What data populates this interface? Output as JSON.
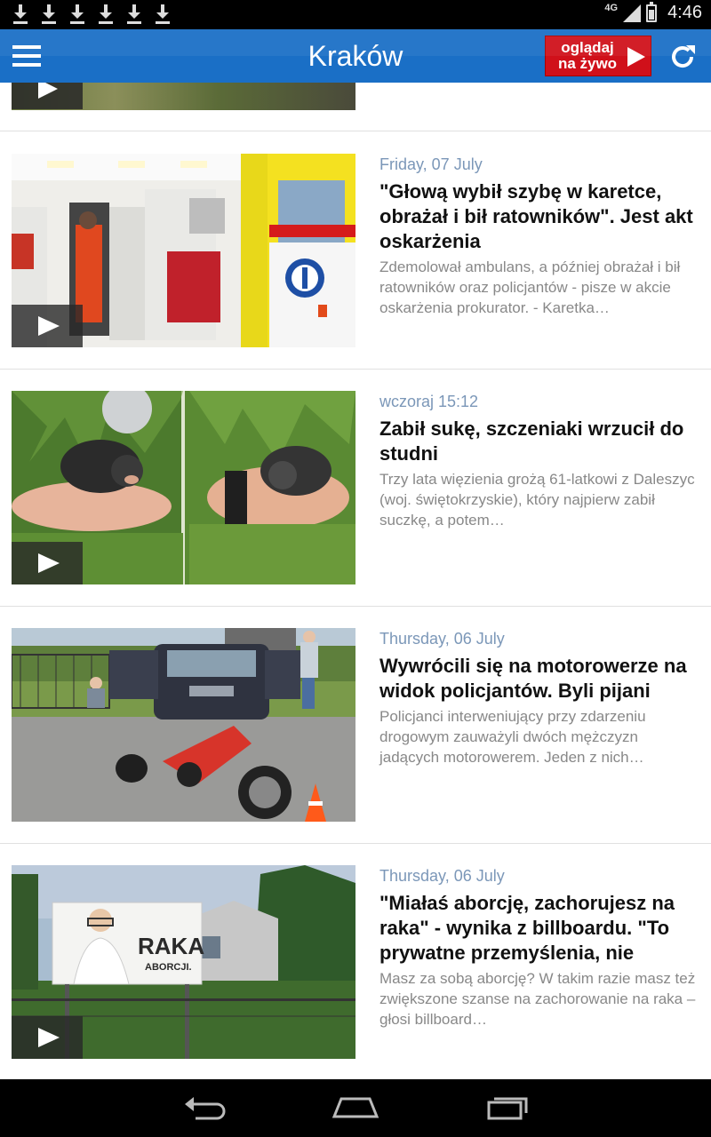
{
  "status_bar": {
    "network": "4G",
    "time": "4:46",
    "download_icons": [
      "download-icon",
      "download-icon",
      "download-icon",
      "download-icon",
      "download-icon",
      "download-icon"
    ]
  },
  "app_bar": {
    "title": "Kraków",
    "live_button_label": "oglądaj na żywo",
    "accent_color": "#1a6fc6",
    "live_color": "#d0101a"
  },
  "articles": [
    {
      "date": "Friday, 07 July",
      "title": "\"Głową wybił szybę w karetce, obrażał i bił ratowników\". Jest akt oskarżenia",
      "description": "Zdemolował ambulans, a później obrażał i bił ratowników oraz policjantów - pisze w akcie oskarżenia prokurator. - Karetka…"
    },
    {
      "date": "wczoraj 15:12",
      "title": "Zabił sukę, szczeniaki wrzucił do studni",
      "description": "Trzy lata więzienia grożą 61-latkowi z Daleszyc (woj. świętokrzyskie), który najpierw zabił suczkę, a potem…"
    },
    {
      "date": "Thursday, 06 July",
      "title": "Wywrócili się na motorowerze na widok policjantów. Byli pijani",
      "description": "Policjanci interweniujący przy zdarzeniu drogowym zauważyli dwóch mężczyzn jadących motorowerem. Jeden z nich…"
    },
    {
      "date": "Thursday, 06 July",
      "title": "\"Miałaś aborcję, zachorujesz na raka\" - wynika z billboardu. \"To prywatne przemyślenia, nie",
      "description": "Masz za sobą aborcję? W takim razie masz też zwiększone szanse na zachorowanie na raka – głosi billboard…"
    }
  ],
  "billboard_text": "RAKA",
  "billboard_subtext": "ABORCJI."
}
